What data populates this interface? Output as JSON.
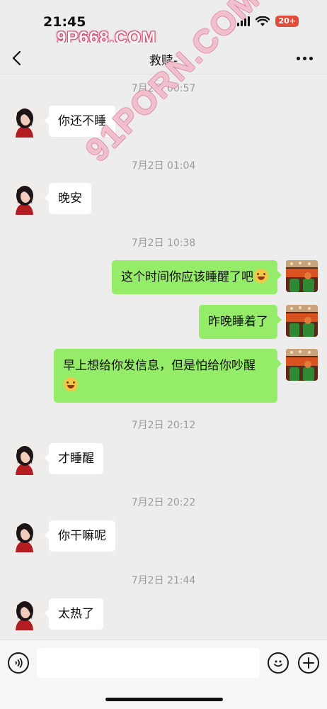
{
  "status_bar": {
    "time": "21:45",
    "battery": "20+"
  },
  "watermarks": {
    "top": "9P668.COM",
    "diagonal": "91PORN.COM"
  },
  "nav": {
    "title": "救赎-",
    "back_icon": "chevron-left-icon",
    "more_icon": "ellipsis-icon"
  },
  "messages": [
    {
      "type": "timestamp",
      "text": "7月2日 00:57"
    },
    {
      "type": "in",
      "text": "你还不睡"
    },
    {
      "type": "timestamp",
      "text": "7月2日 01:04"
    },
    {
      "type": "in",
      "text": "晚安"
    },
    {
      "type": "timestamp",
      "text": "7月2日 10:38"
    },
    {
      "type": "out",
      "text": "这个时间你应该睡醒了吧",
      "emoji": "laughing-tears-emoji"
    },
    {
      "type": "out",
      "text": "昨晚睡着了"
    },
    {
      "type": "out",
      "text": "早上想给你发信息，但是怕给你吵醒",
      "emoji": "rolling-laughing-emoji"
    },
    {
      "type": "timestamp",
      "text": "7月2日 20:12"
    },
    {
      "type": "in",
      "text": "才睡醒"
    },
    {
      "type": "timestamp",
      "text": "7月2日 20:22"
    },
    {
      "type": "in",
      "text": "你干嘛呢"
    },
    {
      "type": "timestamp",
      "text": "7月2日 21:44"
    },
    {
      "type": "in",
      "text": "太热了"
    }
  ],
  "input_bar": {
    "placeholder": "",
    "voice_icon": "voice-icon",
    "emoji_icon": "smile-icon",
    "plus_icon": "plus-icon"
  },
  "colors": {
    "outgoing_bubble": "#95ec69",
    "incoming_bubble": "#ffffff",
    "background": "#ededed",
    "battery": "#e24c3c"
  }
}
